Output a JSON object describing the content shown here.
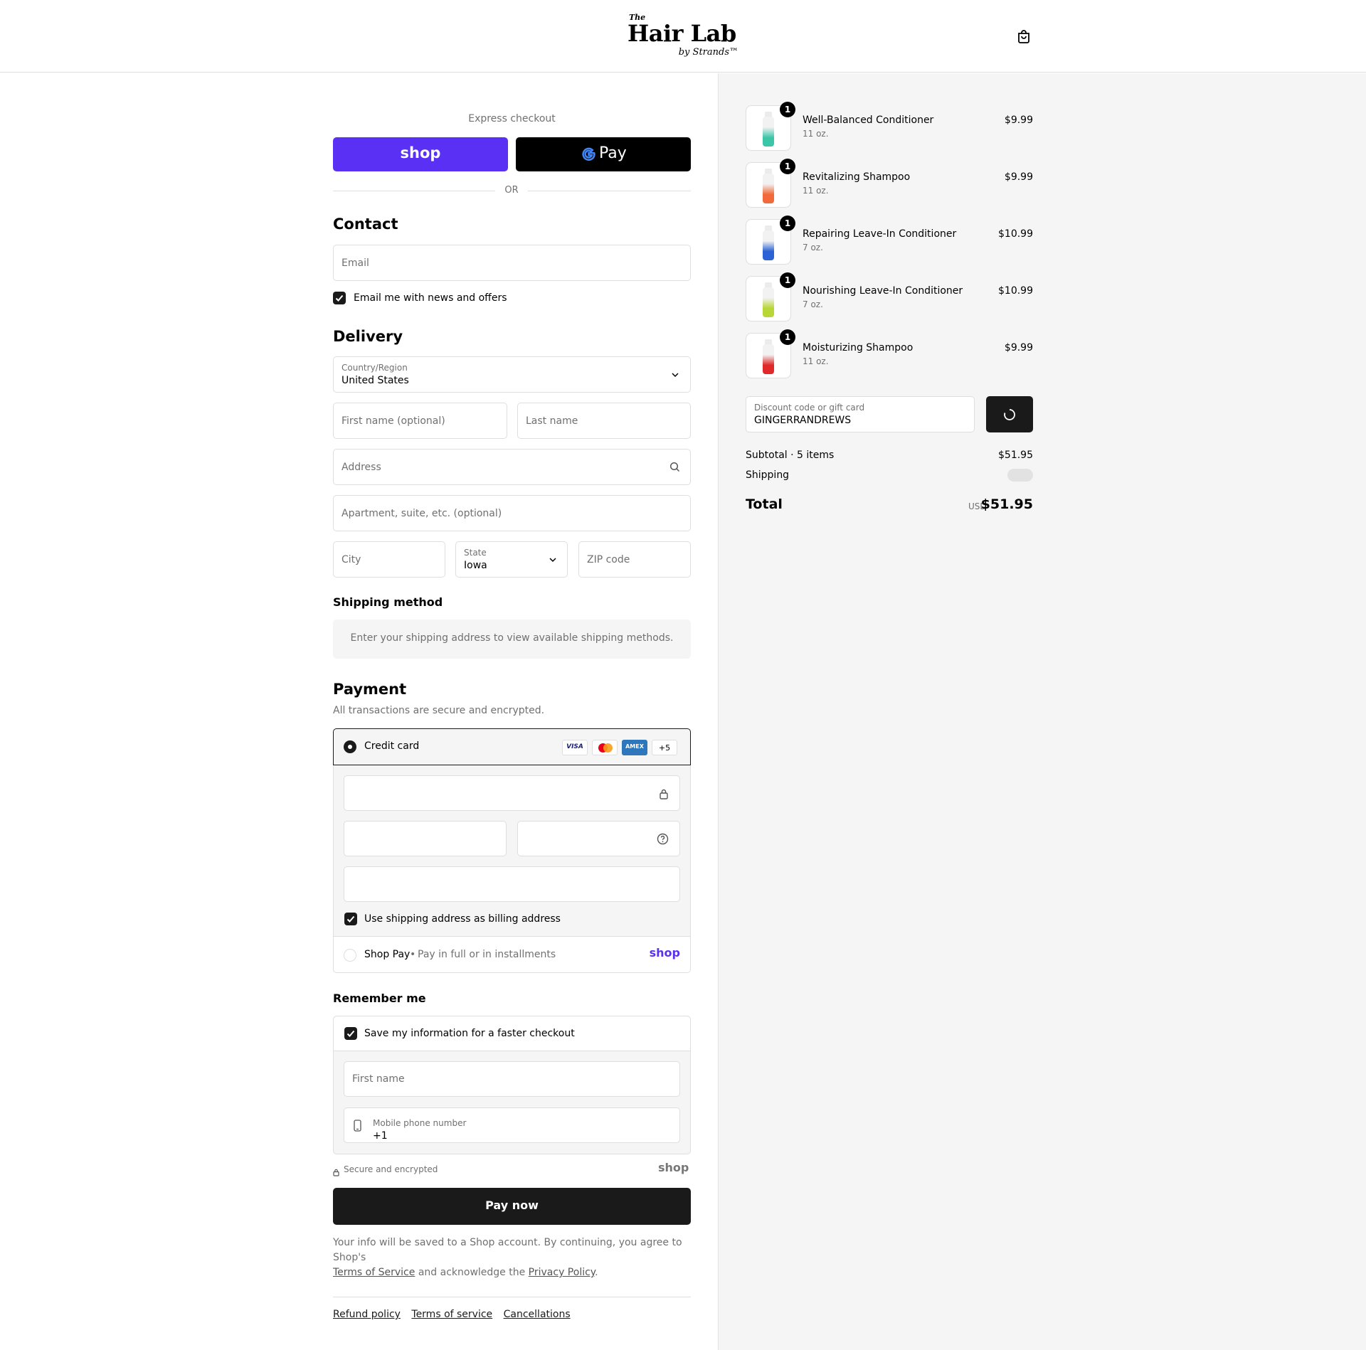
{
  "header": {
    "logo_small": "The",
    "logo_main": "Hair Lab",
    "logo_by": "by Strands™"
  },
  "express": {
    "label": "Express checkout",
    "shop_label": "shop",
    "gpay_label": "Pay",
    "or_label": "OR"
  },
  "contact": {
    "title": "Contact",
    "email_placeholder": "Email",
    "news_label": "Email me with news and offers",
    "news_checked": true
  },
  "delivery": {
    "title": "Delivery",
    "country_label": "Country/Region",
    "country_value": "United States",
    "first_name_placeholder": "First name (optional)",
    "last_name_placeholder": "Last name",
    "address_placeholder": "Address",
    "apartment_placeholder": "Apartment, suite, etc. (optional)",
    "city_placeholder": "City",
    "state_label": "State",
    "state_value": "Iowa",
    "zip_placeholder": "ZIP code"
  },
  "shipping_method": {
    "title": "Shipping method",
    "message": "Enter your shipping address to view available shipping methods."
  },
  "payment": {
    "title": "Payment",
    "subtitle": "All transactions are secure and encrypted.",
    "credit_card_label": "Credit card",
    "card_brands": [
      "VISA",
      "Mastercard",
      "AMEX"
    ],
    "more_brands": "+5",
    "billing_label": "Use shipping address as billing address",
    "shop_pay_label": "Shop Pay",
    "shop_pay_sub": "Pay in full or in installments",
    "shop_pay_logo": "shop"
  },
  "remember": {
    "title": "Remember me",
    "save_label": "Save my information for a faster checkout",
    "first_name_placeholder": "First name",
    "phone_label": "Mobile phone number",
    "phone_value": "+1",
    "secure_label": "Secure and encrypted",
    "shop_logo": "shop"
  },
  "pay_button": "Pay now",
  "legal": {
    "text1": "Your info will be saved to a Shop account. By continuing, you agree to Shop's",
    "terms_link": "Terms of Service",
    "text2": "and acknowledge the",
    "privacy_link": "Privacy Policy",
    "text3": "."
  },
  "footer_links": [
    "Refund policy",
    "Terms of service",
    "Cancellations"
  ],
  "cart_items": [
    {
      "name": "Well-Balanced Conditioner",
      "size": "11 oz.",
      "price": "$9.99",
      "qty": "1",
      "color": "#3cc6a8"
    },
    {
      "name": "Revitalizing Shampoo",
      "size": "11 oz.",
      "price": "$9.99",
      "qty": "1",
      "color": "#f26a3b"
    },
    {
      "name": "Repairing Leave-In Conditioner",
      "size": "7 oz.",
      "price": "$10.99",
      "qty": "1",
      "color": "#2b63d6"
    },
    {
      "name": "Nourishing Leave-In Conditioner",
      "size": "7 oz.",
      "price": "$10.99",
      "qty": "1",
      "color": "#b8d636"
    },
    {
      "name": "Moisturizing Shampoo",
      "size": "11 oz.",
      "price": "$9.99",
      "qty": "1",
      "color": "#e02a2a"
    }
  ],
  "discount": {
    "label": "Discount code or gift card",
    "value": "GINGERRANDREWS"
  },
  "summary": {
    "subtotal_label": "Subtotal · 5 items",
    "subtotal_value": "$51.95",
    "shipping_label": "Shipping",
    "total_label": "Total",
    "currency": "USD",
    "total_value": "$51.95"
  }
}
